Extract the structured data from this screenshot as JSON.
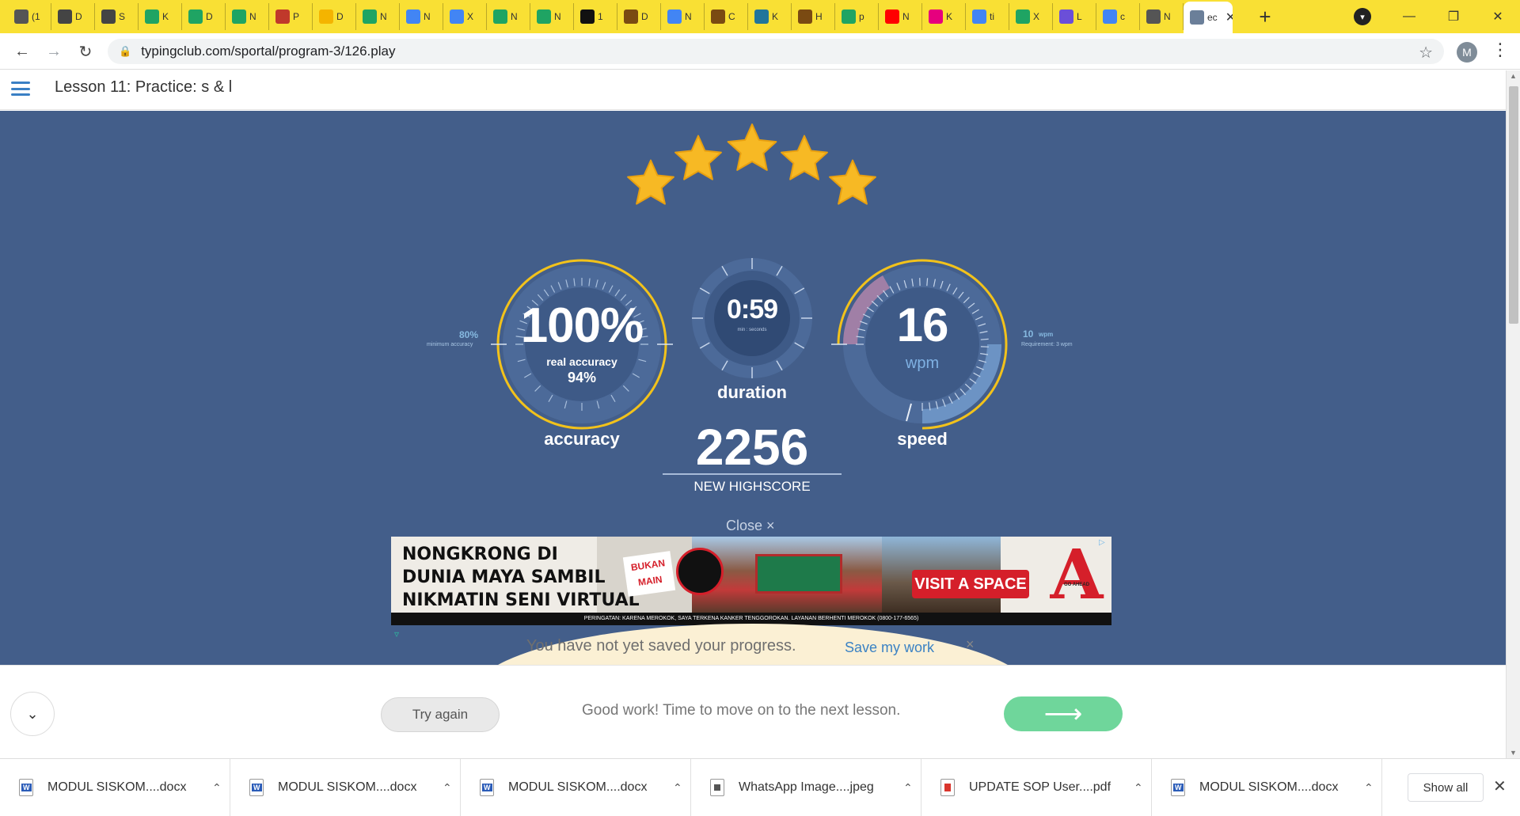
{
  "browser": {
    "tabs": [
      {
        "icon": "audio-tab-icon",
        "label": "(1",
        "color": "#555555"
      },
      {
        "icon": "globe-icon",
        "label": "D",
        "color": "#444444"
      },
      {
        "icon": "globe-icon",
        "label": "S",
        "color": "#444444"
      },
      {
        "icon": "google-drive-icon",
        "label": "K",
        "color": "#1fa463"
      },
      {
        "icon": "google-drive-icon",
        "label": "D",
        "color": "#1fa463"
      },
      {
        "icon": "google-drive-icon",
        "label": "N",
        "color": "#1fa463"
      },
      {
        "icon": "gift-icon",
        "label": "P",
        "color": "#c0392b"
      },
      {
        "icon": "classroom-icon",
        "label": "D",
        "color": "#f4b400"
      },
      {
        "icon": "google-drive-icon",
        "label": "N",
        "color": "#1fa463"
      },
      {
        "icon": "google-docs-icon",
        "label": "N",
        "color": "#4285f4"
      },
      {
        "icon": "google-docs-icon",
        "label": "X",
        "color": "#4285f4"
      },
      {
        "icon": "google-drive-icon",
        "label": "N",
        "color": "#1fa463"
      },
      {
        "icon": "google-drive-icon",
        "label": "N",
        "color": "#1fa463"
      },
      {
        "icon": "b-icon",
        "label": "1",
        "color": "#111111"
      },
      {
        "icon": "r-icon",
        "label": "D",
        "color": "#7a4a12"
      },
      {
        "icon": "google-docs-icon",
        "label": "N",
        "color": "#4285f4"
      },
      {
        "icon": "r-icon",
        "label": "C",
        "color": "#7a4a12"
      },
      {
        "icon": "wordpress-icon",
        "label": "K",
        "color": "#21759b"
      },
      {
        "icon": "r-icon",
        "label": "H",
        "color": "#7a4a12"
      },
      {
        "icon": "google-drive-icon",
        "label": "p",
        "color": "#1fa463"
      },
      {
        "icon": "youtube-icon",
        "label": "N",
        "color": "#ff0000"
      },
      {
        "icon": "ef-icon",
        "label": "K",
        "color": "#e6007e"
      },
      {
        "icon": "google-icon",
        "label": "ti",
        "color": "#4285f4"
      },
      {
        "icon": "google-drive-icon",
        "label": "X",
        "color": "#1fa463"
      },
      {
        "icon": "purple-app-icon",
        "label": "L",
        "color": "#6b4fd8"
      },
      {
        "icon": "google-icon",
        "label": "c",
        "color": "#4285f4"
      },
      {
        "icon": "chrome-icon",
        "label": "N",
        "color": "#555555"
      }
    ],
    "active_tab_label": "ec",
    "url": "typingclub.com/sportal/program-3/126.play",
    "profile_initial": "M"
  },
  "page": {
    "lesson_title": "Lesson 11: Practice: s & l",
    "stars": 5
  },
  "results": {
    "accuracy": {
      "value": "100%",
      "real_label": "real accuracy",
      "real_value": "94%",
      "label": "accuracy",
      "minimum_value": "80%",
      "minimum_label": "minimum accuracy"
    },
    "duration": {
      "value": "0:59",
      "unit_label": "min : seconds",
      "label": "duration"
    },
    "speed": {
      "value": "16",
      "unit": "wpm",
      "label": "speed",
      "target_value": "10",
      "target_unit": "wpm",
      "requirement": "Requirement: 3 wpm"
    },
    "highscore": {
      "value": "2256",
      "label": "NEW HIGHSCORE"
    }
  },
  "ad": {
    "close_label": "Close",
    "close_icon": "×",
    "headline": [
      "NONGKRONG DI",
      "DUNIA MAYA SAMBIL",
      "NIKMATIN SENI VIRTUAL"
    ],
    "sticker": "BUKAN MAIN",
    "cta": "VISIT A SPACE",
    "logo_mark": "A",
    "logo_sub": "GO AHEAD",
    "warning": "PERINGATAN: KARENA MEROKOK, SAYA TERKENA KANKER TENGGOROKAN. LAYANAN BERHENTI MEROKOK (0800-177-6565)"
  },
  "save_banner": {
    "text": "You have not yet saved your progress.",
    "link": "Save my work",
    "close": "×"
  },
  "actions": {
    "try_again": "Try again",
    "message": "Good work! Time to move on to the next lesson.",
    "next_arrow": "⟶"
  },
  "downloads": {
    "items": [
      {
        "name": "MODUL SISKOM....docx",
        "type": "word"
      },
      {
        "name": "MODUL SISKOM....docx",
        "type": "word"
      },
      {
        "name": "MODUL SISKOM....docx",
        "type": "word"
      },
      {
        "name": "WhatsApp Image....jpeg",
        "type": "img"
      },
      {
        "name": "UPDATE SOP User....pdf",
        "type": "pdf"
      },
      {
        "name": "MODUL SISKOM....docx",
        "type": "word"
      }
    ],
    "show_all": "Show all"
  },
  "colors": {
    "tabstrip": "#f9e034",
    "page_bg": "#435e8a",
    "gauge_gold": "#f2c21b",
    "star": "#f7b924",
    "next_button": "#6fd69b",
    "link": "#3b82c4"
  }
}
